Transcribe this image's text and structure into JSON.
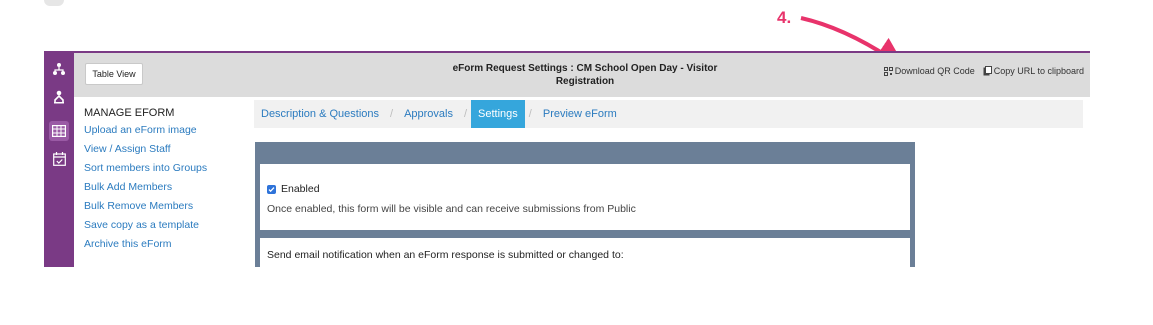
{
  "annotation": {
    "step": "4."
  },
  "topbar": {
    "table_view_label": "Table View",
    "title": "eForm Request Settings : CM School Open Day - Visitor Registration",
    "download_qr_label": "Download QR Code",
    "copy_url_label": "Copy URL to clipboard"
  },
  "manage": {
    "title": "MANAGE EFORM",
    "links": [
      "Upload an eForm image",
      "View / Assign Staff",
      "Sort members into Groups",
      "Bulk Add Members",
      "Bulk Remove Members",
      "Save copy as a template",
      "Archive this eForm"
    ]
  },
  "tabs": [
    {
      "label": "Description & Questions",
      "active": false
    },
    {
      "label": "Approvals",
      "active": false
    },
    {
      "label": "Settings",
      "active": true
    },
    {
      "label": "Preview eForm",
      "active": false
    }
  ],
  "tab_separator": "/",
  "settings": {
    "enabled_label": "Enabled",
    "enabled_checked": true,
    "enabled_description": "Once enabled, this form will be visible and can receive submissions from Public",
    "notify_text": "Send email notification when an eForm response is submitted or changed to:"
  },
  "colors": {
    "accent": "#7a3a85",
    "link": "#2b7bbf",
    "active_tab": "#35a6dc",
    "panel": "#6b7f97",
    "annotation": "#e8336b"
  },
  "icons": [
    "org-chart-icon",
    "person-icon",
    "table-grid-icon",
    "calendar-check-icon",
    "qr-code-icon",
    "clipboard-icon"
  ]
}
